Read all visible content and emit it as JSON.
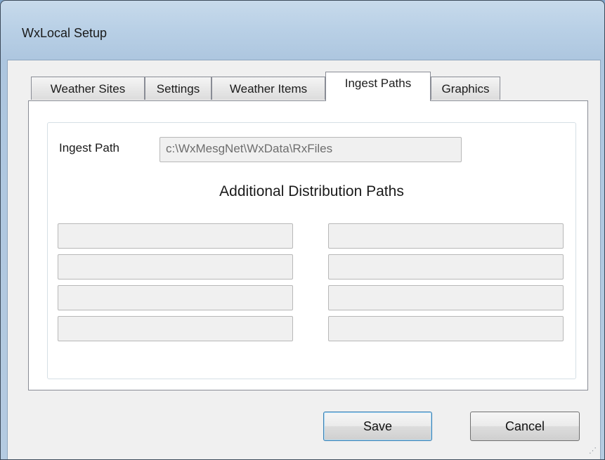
{
  "window": {
    "title": "WxLocal Setup"
  },
  "tabs": [
    {
      "label": "Weather Sites"
    },
    {
      "label": "Settings"
    },
    {
      "label": "Weather Items"
    },
    {
      "label": "Ingest Paths",
      "selected": true
    },
    {
      "label": "Graphics"
    }
  ],
  "ingest": {
    "label": "Ingest Path",
    "value": "c:\\WxMesgNet\\WxData\\RxFiles"
  },
  "distribution": {
    "title": "Additional Distribution Paths",
    "left_paths": [
      "",
      "",
      "",
      ""
    ],
    "right_paths": [
      "",
      "",
      "",
      ""
    ]
  },
  "buttons": {
    "save": "Save",
    "cancel": "Cancel"
  }
}
